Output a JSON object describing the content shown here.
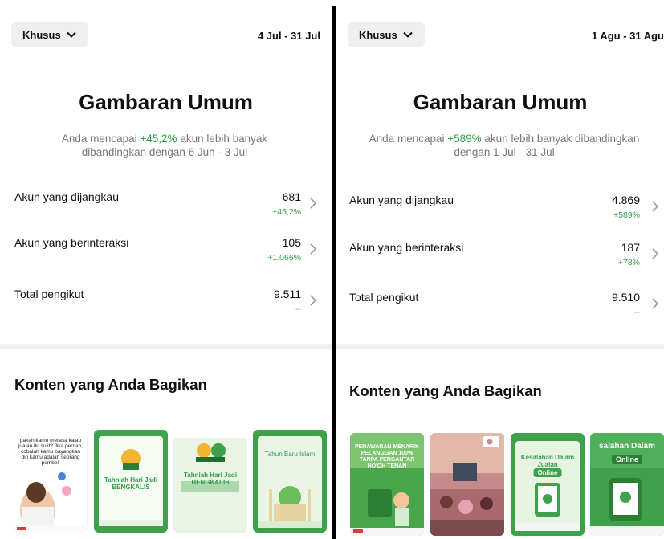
{
  "left_panel": {
    "filter_label": "Khusus",
    "date_range": "4 Jul - 31 Jul",
    "overview_title": "Gambaran Umum",
    "subtitle_prefix": "Anda mencapai ",
    "subtitle_pct": "+45,2%",
    "subtitle_suffix": " akun lebih banyak dibandingkan dengan 6 Jun - 3 Jul",
    "metrics": [
      {
        "label": "Akun yang dijangkau",
        "value": "681",
        "change": "+45,2%"
      },
      {
        "label": "Akun yang berinteraksi",
        "value": "105",
        "change": "+1.066%"
      },
      {
        "label": "Total pengikut",
        "value": "9.511",
        "change": "--"
      }
    ],
    "content_title": "Konten yang Anda Bagikan",
    "thumbnails": [
      {
        "caption": "pakah kamu merasa kalau jualan itu sulit? Jika pernah, cobalah kamu bayangkan diri kamu adalah seorang pembeli"
      },
      {
        "caption": "Tahniah Hari Jadi BENGKALIS"
      },
      {
        "caption": "Tahniah Hari Jadi BENGKALIS"
      },
      {
        "caption": "Tahun Baru Islam"
      }
    ]
  },
  "right_panel": {
    "filter_label": "Khusus",
    "date_range": "1 Agu - 31 Agu",
    "overview_title": "Gambaran Umum",
    "subtitle_prefix": "Anda mencapai ",
    "subtitle_pct": "+589%",
    "subtitle_suffix": " akun lebih banyak dibandingkan dengan 1 Jul - 31 Jul",
    "metrics": [
      {
        "label": "Akun yang dijangkau",
        "value": "4.869",
        "change": "+589%"
      },
      {
        "label": "Akun yang berinteraksi",
        "value": "187",
        "change": "+78%"
      },
      {
        "label": "Total pengikut",
        "value": "9.510",
        "change": "--"
      }
    ],
    "content_title": "Konten yang Anda Bagikan",
    "thumbnails": [
      {
        "caption": "PENAWARAN MENARIK PELANGGAN 100% TANPA PENGANTAR HO'OH TENAN"
      },
      {
        "caption": ""
      },
      {
        "caption": "Kesalahan Dalam Jualan",
        "badge": "Online"
      },
      {
        "caption": "salahan Dalam",
        "badge": "Online"
      }
    ]
  },
  "colors": {
    "accent_green": "#2e9e4a",
    "thumb_green": "#3fa24a",
    "button_bg": "#efefef"
  }
}
